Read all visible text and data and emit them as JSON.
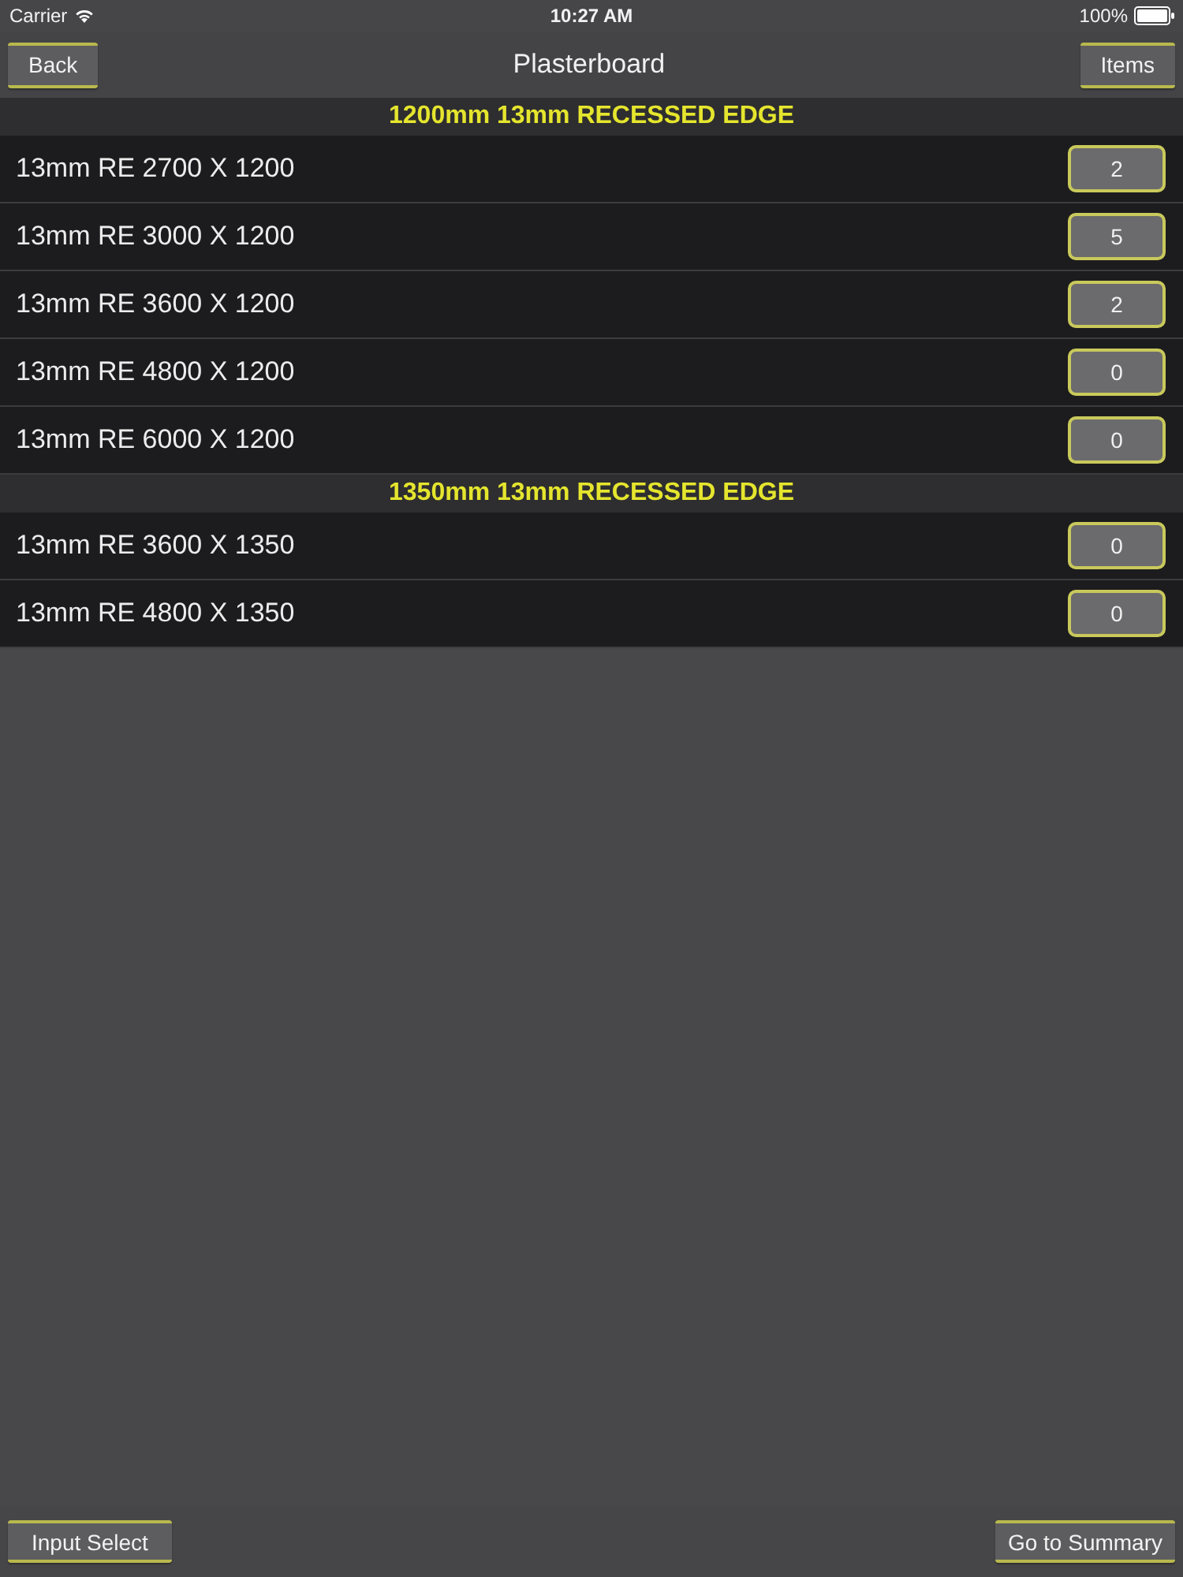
{
  "status_bar": {
    "carrier": "Carrier",
    "time": "10:27 AM",
    "battery": "100%"
  },
  "nav_bar": {
    "back_button": "Back",
    "title": "Plasterboard",
    "items_button": "Items"
  },
  "sections": [
    {
      "header": "1200mm 13mm RECESSED EDGE",
      "rows": [
        {
          "name": "13mm RE 2700 X 1200",
          "quantity": "2"
        },
        {
          "name": "13mm RE 3000 X 1200",
          "quantity": "5"
        },
        {
          "name": "13mm RE 3600 X 1200",
          "quantity": "2"
        },
        {
          "name": "13mm RE 4800 X 1200",
          "quantity": "0"
        },
        {
          "name": "13mm RE 6000 X 1200",
          "quantity": "0"
        }
      ]
    },
    {
      "header": "1350mm 13mm RECESSED EDGE",
      "rows": [
        {
          "name": "13mm RE 3600 X 1350",
          "quantity": "0"
        },
        {
          "name": "13mm RE 4800 X 1350",
          "quantity": "0"
        }
      ]
    }
  ],
  "toolbar": {
    "input_select_button": "Input Select",
    "summary_button": "Go to Summary"
  }
}
